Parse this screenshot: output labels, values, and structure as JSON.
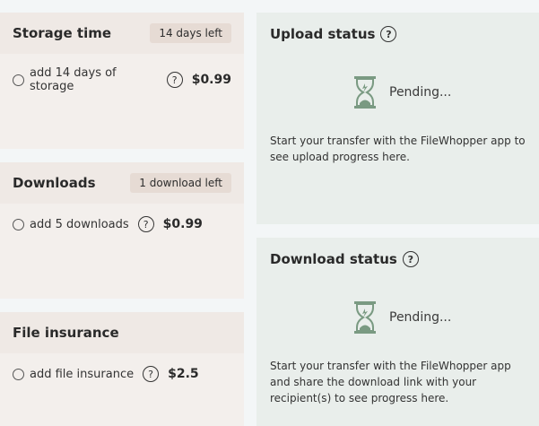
{
  "storage": {
    "title": "Storage time",
    "badge": "14 days left",
    "option_label": "add 14 days of storage",
    "price": "$0.99"
  },
  "downloads": {
    "title": "Downloads",
    "badge": "1 download left",
    "option_label": "add 5 downloads",
    "price": "$0.99"
  },
  "insurance": {
    "title": "File insurance",
    "option_label": "add file insurance",
    "price": "$2.5"
  },
  "upload_status": {
    "title": "Upload status",
    "state": "Pending...",
    "description": "Start your transfer with the FileWhopper app to see upload progress here."
  },
  "download_status": {
    "title": "Download status",
    "state": "Pending...",
    "description": "Start your transfer with the FileWhopper app and share the download link with your recipient(s) to see progress here."
  },
  "icons": {
    "help": "question-circle-icon",
    "status": "hourglass-icon",
    "hourglass_color": "#7a9a82"
  }
}
